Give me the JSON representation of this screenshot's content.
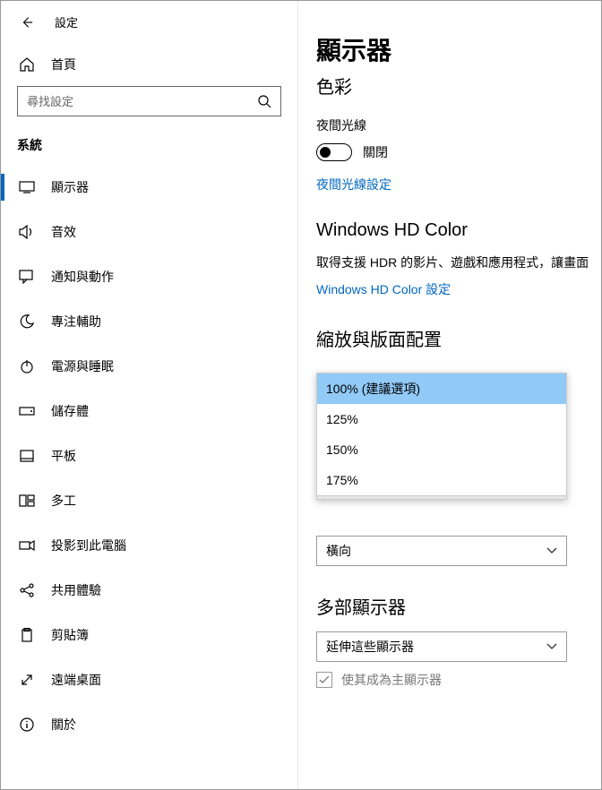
{
  "window": {
    "title": "設定"
  },
  "sidebar": {
    "home": "首頁",
    "search_placeholder": "尋找設定",
    "section": "系統",
    "items": [
      {
        "label": "顯示器"
      },
      {
        "label": "音效"
      },
      {
        "label": "通知與動作"
      },
      {
        "label": "專注輔助"
      },
      {
        "label": "電源與睡眠"
      },
      {
        "label": "儲存體"
      },
      {
        "label": "平板"
      },
      {
        "label": "多工"
      },
      {
        "label": "投影到此電腦"
      },
      {
        "label": "共用體驗"
      },
      {
        "label": "剪貼簿"
      },
      {
        "label": "遠端桌面"
      },
      {
        "label": "關於"
      }
    ]
  },
  "main": {
    "title": "顯示器",
    "color_heading": "色彩",
    "nightlight_label": "夜間光線",
    "nightlight_state": "關閉",
    "nightlight_link": "夜間光線設定",
    "hdcolor_heading": "Windows HD Color",
    "hdcolor_desc": "取得支援 HDR 的影片、遊戲和應用程式，讓畫面",
    "hdcolor_link": "Windows HD Color 設定",
    "scale_heading": "縮放與版面配置",
    "scale_options": [
      "100% (建議選項)",
      "125%",
      "150%",
      "175%"
    ],
    "orientation_value": "橫向",
    "multimon_heading": "多部顯示器",
    "multimon_value": "延伸這些顯示器",
    "primary_checkbox": "使其成為主顯示器"
  }
}
